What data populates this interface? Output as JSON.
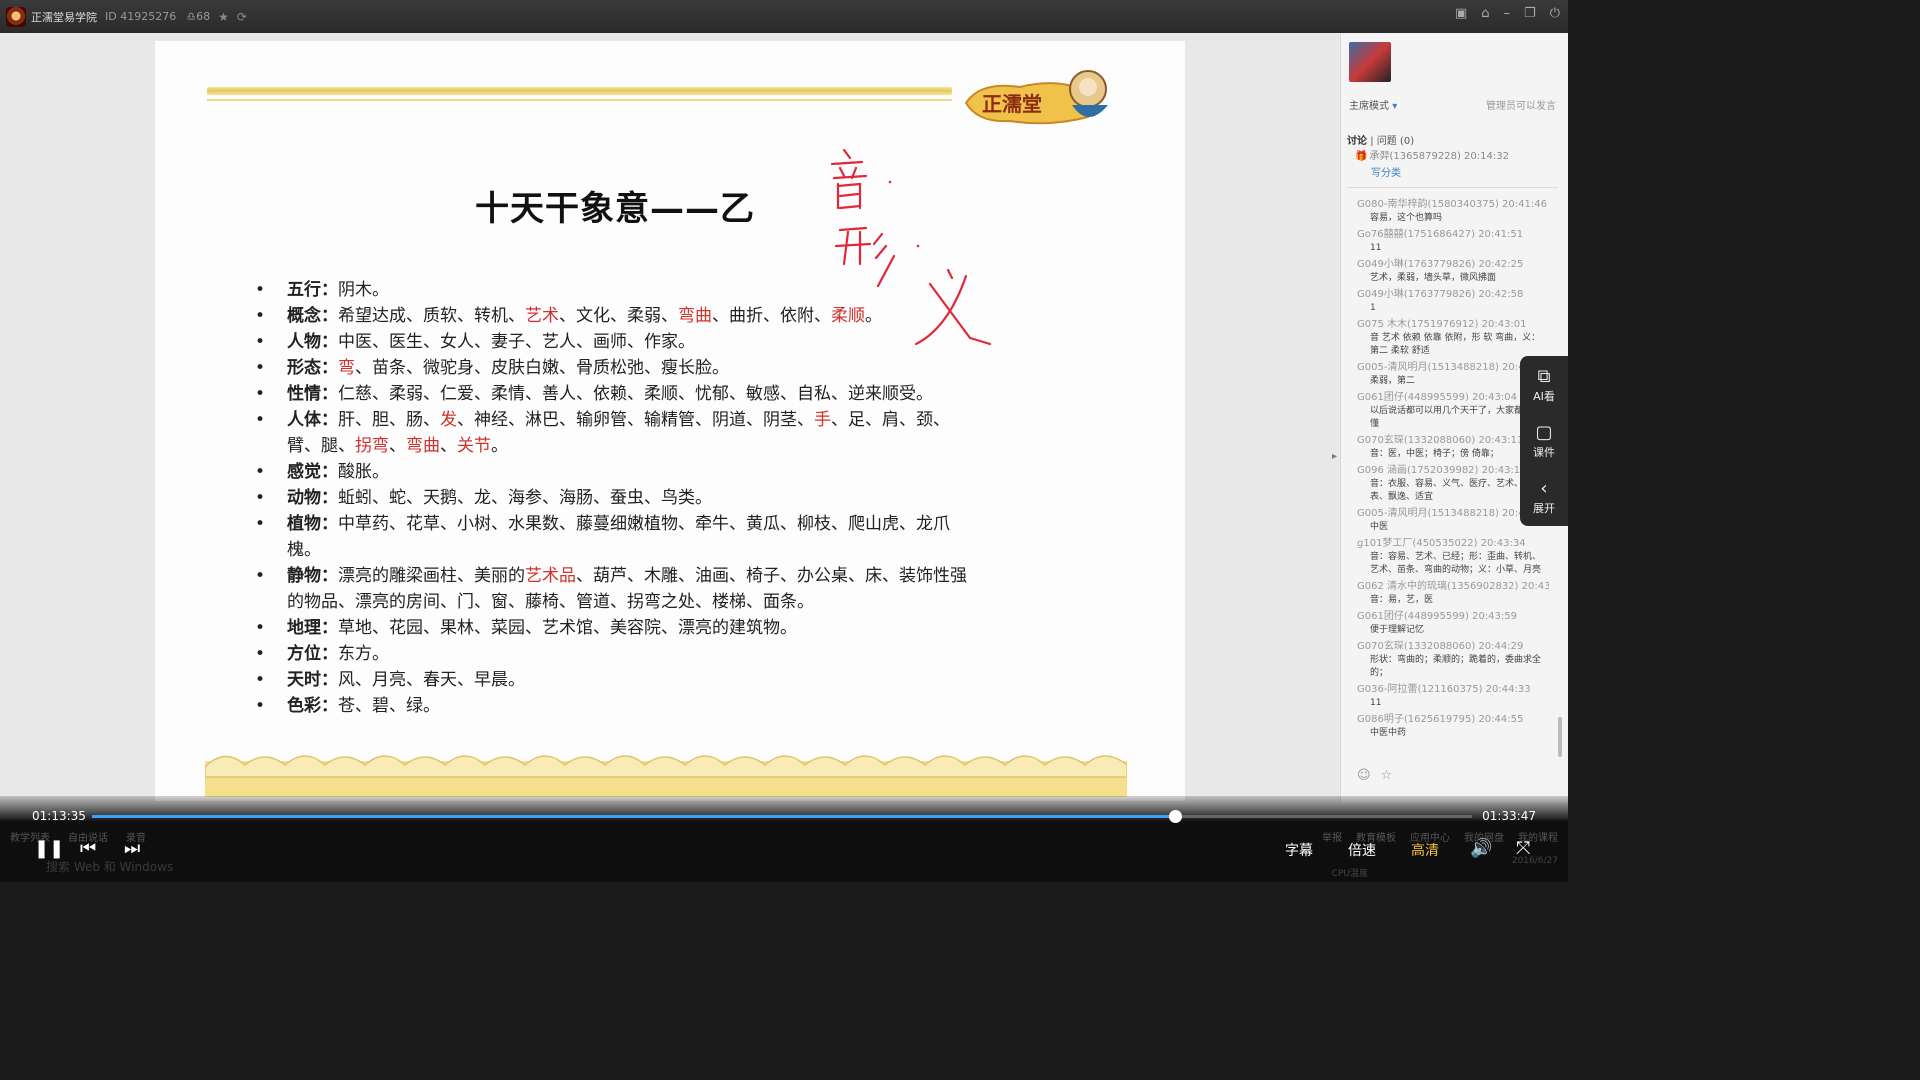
{
  "titlebar": {
    "app_name": "正濡堂易学院",
    "room_id": "ID 41925276",
    "viewers": "68"
  },
  "slide": {
    "title": "十天干象意——乙",
    "items": [
      {
        "term": "五行",
        "parts": [
          [
            "阴木。",
            false
          ]
        ]
      },
      {
        "term": "概念",
        "parts": [
          [
            "希望达成、质软、转机、",
            false
          ],
          [
            "艺术",
            true
          ],
          [
            "、文化、柔弱、",
            false
          ],
          [
            "弯曲",
            true
          ],
          [
            "、曲折、依附、",
            false
          ],
          [
            "柔顺",
            true
          ],
          [
            "。",
            false
          ]
        ]
      },
      {
        "term": "人物",
        "parts": [
          [
            "中医、医生、女人、妻子、艺人、画师、作家。",
            false
          ]
        ]
      },
      {
        "term": "形态",
        "parts": [
          [
            "弯",
            true
          ],
          [
            "、苗条、微驼身、皮肤白嫩、骨质松弛、瘦长脸。",
            false
          ]
        ]
      },
      {
        "term": "性情",
        "parts": [
          [
            "仁慈、柔弱、仁爱、柔情、善人、依赖、柔顺、忧郁、敏感、自私、逆来顺受。",
            false
          ]
        ]
      },
      {
        "term": "人体",
        "parts": [
          [
            "肝、胆、肠、",
            false
          ],
          [
            "发",
            true
          ],
          [
            "、神经、淋巴、输卵管、输精管、阴道、阴茎、",
            false
          ],
          [
            "手",
            true
          ],
          [
            "、足、肩、颈、臂、腿、",
            false
          ],
          [
            "拐弯",
            true
          ],
          [
            "、",
            false
          ],
          [
            "弯曲",
            true
          ],
          [
            "、",
            false
          ],
          [
            "关节",
            true
          ],
          [
            "。",
            false
          ]
        ]
      },
      {
        "term": "感觉",
        "parts": [
          [
            "酸胀。",
            false
          ]
        ]
      },
      {
        "term": "动物",
        "parts": [
          [
            "蚯蚓、蛇、天鹅、龙、海参、海肠、蚕虫、鸟类。",
            false
          ]
        ]
      },
      {
        "term": "植物",
        "parts": [
          [
            "中草药、花草、小树、水果数、藤蔓细嫩植物、牵牛、黄瓜、柳枝、爬山虎、龙爪槐。",
            false
          ]
        ]
      },
      {
        "term": "静物",
        "parts": [
          [
            "漂亮的雕梁画柱、美丽的",
            false
          ],
          [
            "艺术品",
            true
          ],
          [
            "、葫芦、木雕、油画、椅子、办公桌、床、装饰性强的物品、漂亮的房间、门、窗、藤椅、管道、拐弯之处、楼梯、面条。",
            false
          ]
        ]
      },
      {
        "term": "地理",
        "parts": [
          [
            "草地、花园、果林、菜园、艺术馆、美容院、漂亮的建筑物。",
            false
          ]
        ]
      },
      {
        "term": "方位",
        "parts": [
          [
            "东方。",
            false
          ]
        ]
      },
      {
        "term": "天时",
        "parts": [
          [
            "风、月亮、春天、早晨。",
            false
          ]
        ]
      },
      {
        "term": "色彩",
        "parts": [
          [
            "苍、碧、绿。",
            false
          ]
        ]
      }
    ]
  },
  "panel": {
    "mode": "主席模式",
    "admin_note": "管理员可以发言",
    "tab_discuss": "讨论",
    "tab_questions": "问题 (0)",
    "pinned_user": "承羿(1365879228) 20:14:32",
    "pinned_action": "写分类",
    "messages": [
      {
        "who": "G080-南华梓韵(1580340375) 20:41:46",
        "text": "容易，这个也算吗"
      },
      {
        "who": "Go76囍囍(1751686427) 20:41:51",
        "text": "11"
      },
      {
        "who": "G049小琳(1763779826) 20:42:25",
        "text": "艺术，柔弱，墙头草，微风拂面"
      },
      {
        "who": "G049小琳(1763779826) 20:42:58",
        "text": "1"
      },
      {
        "who": "G075 木木(1751976912) 20:43:01",
        "text": "音 艺术 依赖 依靠 依附，形 软 弯曲，义：第二 柔软 舒适"
      },
      {
        "who": "G005-清风明月(1513488218) 20:43:",
        "text": "柔弱，第二"
      },
      {
        "who": "G061团仔(448995599) 20:43:04",
        "text": "以后说话都可以用几个天干了，大家都看不懂"
      },
      {
        "who": "G070玄琛(1332088060) 20:43:11",
        "text": "音：医，中医；椅子；傍 倚靠；"
      },
      {
        "who": "G096 涵画(1752039982) 20:43:13",
        "text": "音：衣服、容易、义气、医疗、艺术、仪表、飘逸、适宜"
      },
      {
        "who": "G005-清风明月(1513488218) 20:43:",
        "text": "中医"
      },
      {
        "who": "g101梦工厂(450535022) 20:43:34",
        "text": "音：容易、艺术、已经；形：歪曲、转机、艺术、苗条、弯曲的动物；义：小草、月亮"
      },
      {
        "who": "G062 清水中的琉璃(1356902832) 20:43:47",
        "text": "音：易，艺，医"
      },
      {
        "who": "G061团仔(448995599) 20:43:59",
        "text": "便于理解记忆"
      },
      {
        "who": "G070玄琛(1332088060) 20:44:29",
        "text": "形状：弯曲的；柔顺的；跪着的，委曲求全的；"
      },
      {
        "who": "G036-阿拉蕾(121160375) 20:44:33",
        "text": "11"
      },
      {
        "who": "G086明子(1625619795) 20:44:55",
        "text": "中医中药"
      }
    ]
  },
  "floatbar": {
    "ai_label": "AI看",
    "courseware_label": "课件",
    "expand_label": "展开"
  },
  "player": {
    "time_current": "01:13:35",
    "time_total": "01:33:47",
    "progress": 0.785,
    "subtitle_label": "字幕",
    "speed_label": "倍速",
    "quality_label": "高清",
    "under_left": [
      "教学列表",
      "自由说话",
      "录音"
    ],
    "under_right": [
      "举报",
      "教育模板",
      "应用中心",
      "我的网盘",
      "我的课程"
    ]
  },
  "taskbar": {
    "search": "搜索 Web 和 Windows",
    "cpu": "CPU温度",
    "date": "2016/6/27"
  },
  "handwriting": {
    "chars": [
      "音",
      "形",
      "义"
    ]
  }
}
